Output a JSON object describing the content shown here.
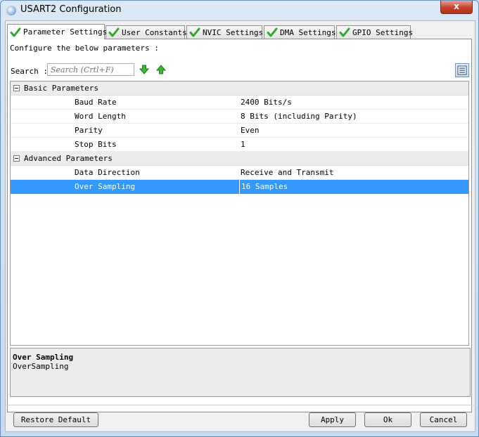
{
  "window": {
    "title": "USART2 Configuration",
    "close_label": "x"
  },
  "tabs": [
    {
      "label": "Parameter Settings",
      "active": true
    },
    {
      "label": "User Constants"
    },
    {
      "label": "NVIC Settings"
    },
    {
      "label": "DMA Settings"
    },
    {
      "label": "GPIO Settings"
    }
  ],
  "config_label": "Configure the below parameters :",
  "search": {
    "label": "Search :",
    "placeholder": "Search (Crtl+F)"
  },
  "groups": [
    {
      "name": "Basic Parameters",
      "params": [
        {
          "name": "Baud Rate",
          "value": "2400 Bits/s"
        },
        {
          "name": "Word Length",
          "value": "8 Bits (including Parity)"
        },
        {
          "name": "Parity",
          "value": "Even"
        },
        {
          "name": "Stop Bits",
          "value": "1"
        }
      ]
    },
    {
      "name": "Advanced Parameters",
      "params": [
        {
          "name": "Data Direction",
          "value": "Receive and Transmit"
        },
        {
          "name": "Over Sampling",
          "value": "16 Samples",
          "selected": true
        }
      ]
    }
  ],
  "description": {
    "title": "Over Sampling",
    "text": "OverSampling"
  },
  "buttons": {
    "restore": "Restore Default",
    "apply": "Apply",
    "ok": "Ok",
    "cancel": "Cancel"
  },
  "icons": {
    "tab_check": "check-icon",
    "find_next": "arrow-down-icon",
    "find_prev": "arrow-up-icon",
    "view": "list-view-icon"
  },
  "colors": {
    "selection": "#3399ff",
    "check": "#34a534"
  }
}
